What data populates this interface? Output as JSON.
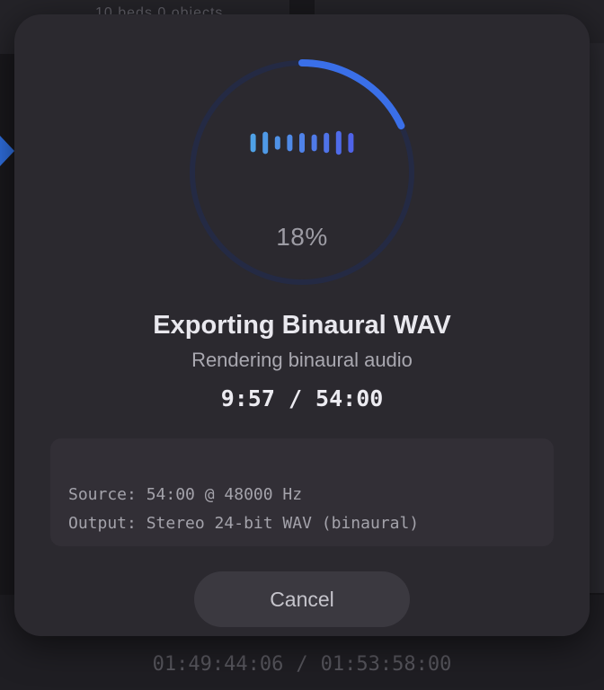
{
  "background": {
    "top_text": "10 beds  0 objects",
    "timecode_current": "01:49:44:06",
    "timecode_separator": "/",
    "timecode_total": "01:53:58:00"
  },
  "dialog": {
    "progress_fraction": 0.18,
    "percent_label": "18%",
    "title": "Exporting Binaural WAV",
    "subtitle": "Rendering binaural audio",
    "progress_time": "9:57 / 54:00",
    "info": {
      "source": "Source: 54:00 @ 48000 Hz",
      "output": "Output: Stereo 24-bit WAV (binaural)"
    },
    "cancel_label": "Cancel"
  },
  "waveform_levels": [
    0.52,
    0.62,
    0.38,
    0.47,
    0.55,
    0.47,
    0.56,
    0.66,
    0.55
  ],
  "colors": {
    "accent": "#3a6fe8",
    "ring_track": "#242a44",
    "wave_light": "#4fa1e6",
    "wave_dark": "#4f63e9",
    "dialog_bg": "#2b292f"
  }
}
